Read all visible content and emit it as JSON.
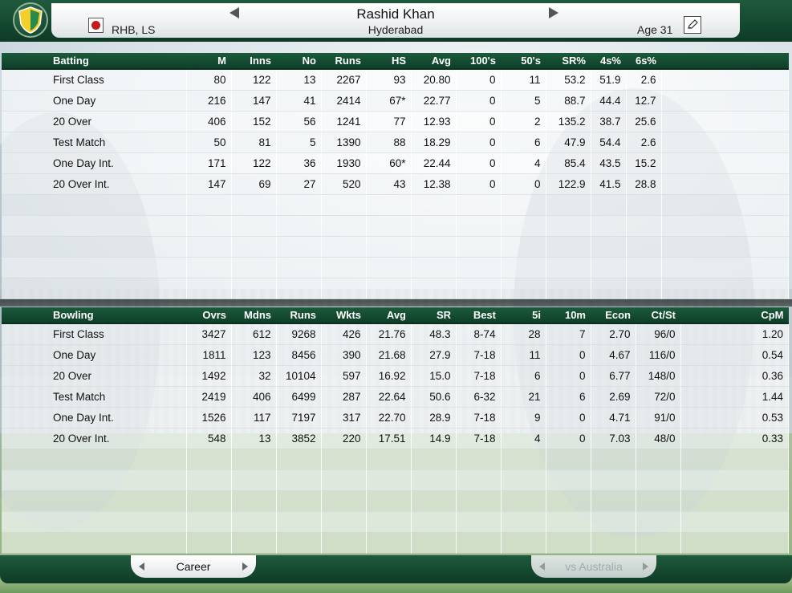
{
  "header": {
    "player_name": "Rashid Khan",
    "team": "Hyderabad",
    "batting_style": "RHB, LS",
    "age": "Age 31"
  },
  "batting": {
    "columns": [
      "Batting",
      "M",
      "Inns",
      "No",
      "Runs",
      "HS",
      "Avg",
      "100's",
      "50's",
      "SR%",
      "4s%",
      "6s%",
      ""
    ],
    "rows": [
      [
        "First Class",
        "80",
        "122",
        "13",
        "2267",
        "93",
        "20.80",
        "0",
        "11",
        "53.2",
        "51.9",
        "2.6",
        ""
      ],
      [
        "One Day",
        "216",
        "147",
        "41",
        "2414",
        "67*",
        "22.77",
        "0",
        "5",
        "88.7",
        "44.4",
        "12.7",
        ""
      ],
      [
        "20 Over",
        "406",
        "152",
        "56",
        "1241",
        "77",
        "12.93",
        "0",
        "2",
        "135.2",
        "38.7",
        "25.6",
        ""
      ],
      [
        "Test Match",
        "50",
        "81",
        "5",
        "1390",
        "88",
        "18.29",
        "0",
        "6",
        "47.9",
        "54.4",
        "2.6",
        ""
      ],
      [
        "One Day Int.",
        "171",
        "122",
        "36",
        "1930",
        "60*",
        "22.44",
        "0",
        "4",
        "85.4",
        "43.5",
        "15.2",
        ""
      ],
      [
        "20 Over Int.",
        "147",
        "69",
        "27",
        "520",
        "43",
        "12.38",
        "0",
        "0",
        "122.9",
        "41.5",
        "28.8",
        ""
      ]
    ],
    "empty_rows": 5
  },
  "bowling": {
    "columns": [
      "Bowling",
      "Ovrs",
      "Mdns",
      "Runs",
      "Wkts",
      "Avg",
      "SR",
      "Best",
      "5i",
      "10m",
      "Econ",
      "Ct/St",
      "CpM"
    ],
    "rows": [
      [
        "First Class",
        "3427",
        "612",
        "9268",
        "426",
        "21.76",
        "48.3",
        "8-74",
        "28",
        "7",
        "2.70",
        "96/0",
        "1.20"
      ],
      [
        "One Day",
        "1811",
        "123",
        "8456",
        "390",
        "21.68",
        "27.9",
        "7-18",
        "11",
        "0",
        "4.67",
        "116/0",
        "0.54"
      ],
      [
        "20 Over",
        "1492",
        "32",
        "10104",
        "597",
        "16.92",
        "15.0",
        "7-18",
        "6",
        "0",
        "6.77",
        "148/0",
        "0.36"
      ],
      [
        "Test Match",
        "2419",
        "406",
        "6499",
        "287",
        "22.64",
        "50.6",
        "6-32",
        "21",
        "6",
        "2.69",
        "72/0",
        "1.44"
      ],
      [
        "One Day Int.",
        "1526",
        "117",
        "7197",
        "317",
        "22.70",
        "28.9",
        "7-18",
        "9",
        "0",
        "4.71",
        "91/0",
        "0.53"
      ],
      [
        "20 Over Int.",
        "548",
        "13",
        "3852",
        "220",
        "17.51",
        "14.9",
        "7-18",
        "4",
        "0",
        "7.03",
        "48/0",
        "0.33"
      ]
    ],
    "empty_rows": 5
  },
  "footer": {
    "career_tab": "Career",
    "vs_tab": "vs Australia"
  },
  "icons": {
    "ball": "cricket-ball-icon",
    "edit": "pencil-icon",
    "logo": "shield-logo-icon"
  },
  "colors": {
    "header_green": "#0e3a26",
    "ball_red": "#c41b1b"
  }
}
